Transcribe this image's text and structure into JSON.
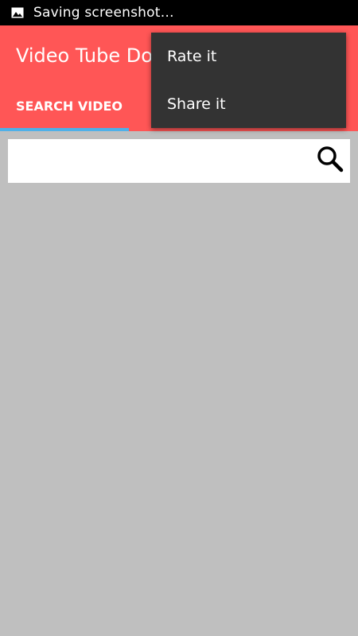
{
  "status_bar": {
    "notification_icon": "image-icon",
    "text": "Saving screenshot…"
  },
  "app_bar": {
    "title": "Video Tube Dov",
    "color": "#ff5656"
  },
  "tabs": [
    {
      "label": "SEARCH VIDEO",
      "selected": true
    }
  ],
  "search": {
    "value": "",
    "placeholder": "",
    "button_icon": "search-icon"
  },
  "overflow_menu": {
    "items": [
      {
        "label": "Rate it"
      },
      {
        "label": "Share it"
      }
    ]
  },
  "colors": {
    "accent": "#ff5656",
    "tab_indicator": "#4fb0e8",
    "menu_background": "#333333",
    "page_background": "#bfbfbf"
  }
}
